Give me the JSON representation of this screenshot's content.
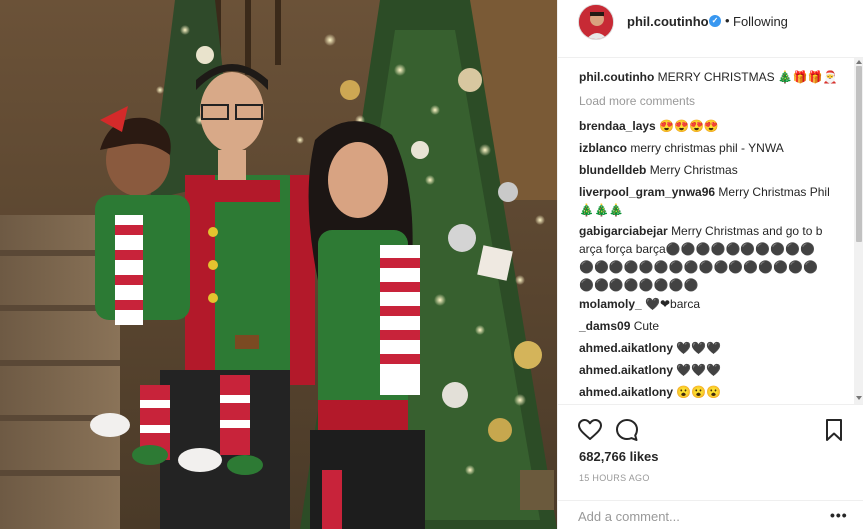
{
  "header": {
    "username": "phil.coutinho",
    "separator": "•",
    "follow_status": "Following"
  },
  "caption": {
    "user": "phil.coutinho",
    "text": "MERRY CHRISTMAS 🎄🎁🎁🎅"
  },
  "load_more_label": "Load more comments",
  "comments": [
    {
      "user": "brendaa_lays",
      "text": "😍😍😍😍"
    },
    {
      "user": "izblanco",
      "text": "merry christmas phil - YNWA"
    },
    {
      "user": "blundelldeb",
      "text": "Merry Christmas"
    },
    {
      "user": "liverpool_gram_ynwa96",
      "text": "Merry Christmas Phil🎄🎄🎄"
    },
    {
      "user": "gabigarciabejar",
      "text": "Merry Christmas and go to barça força barça⚫⚫⚫⚫⚫⚫⚫⚫⚫⚫⚫⚫⚫⚫⚫⚫⚫⚫⚫⚫⚫⚫⚫⚫⚫⚫⚫⚫⚫⚫⚫⚫⚫⚫"
    },
    {
      "user": "molamoly_",
      "text": "🖤❤barca"
    },
    {
      "user": "_dams09",
      "text": "Cute"
    },
    {
      "user": "ahmed.aikatlony",
      "text": "🖤🖤🖤"
    },
    {
      "user": "ahmed.aikatlony",
      "text": "🖤🖤🖤"
    },
    {
      "user": "ahmed.aikatlony",
      "text": "😮😮😮"
    }
  ],
  "likes": "682,766 likes",
  "timestamp": "15 HOURS AGO",
  "add_comment_placeholder": "Add a comment...",
  "more_options": "•••",
  "icons": {
    "like": "heart-icon",
    "comment": "comment-bubble-icon",
    "save": "bookmark-icon",
    "verified": "verified-badge-icon",
    "more": "more-options-icon"
  },
  "colors": {
    "verified": "#3897f0",
    "text": "#262626",
    "muted": "#999999",
    "border": "#efefef"
  }
}
